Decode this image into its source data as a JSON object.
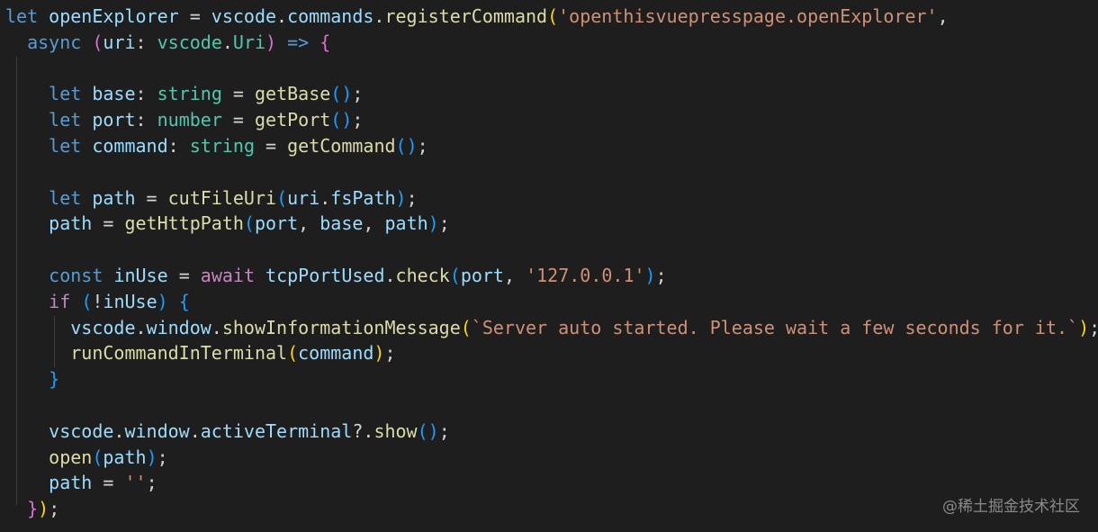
{
  "editor": {
    "lines": [
      [
        [
          "kw",
          "let"
        ],
        [
          "op",
          " "
        ],
        [
          "var",
          "openExplorer"
        ],
        [
          "op",
          " = "
        ],
        [
          "var",
          "vscode"
        ],
        [
          "op",
          "."
        ],
        [
          "var",
          "commands"
        ],
        [
          "op",
          "."
        ],
        [
          "fn",
          "registerCommand"
        ],
        [
          "b1",
          "("
        ],
        [
          "str",
          "'openthisvuepresspage.openExplorer'"
        ],
        [
          "op",
          ","
        ]
      ],
      [
        [
          "op",
          "  "
        ],
        [
          "kw",
          "async"
        ],
        [
          "op",
          " "
        ],
        [
          "b2",
          "("
        ],
        [
          "var",
          "uri"
        ],
        [
          "op",
          ": "
        ],
        [
          "type",
          "vscode"
        ],
        [
          "op",
          "."
        ],
        [
          "type",
          "Uri"
        ],
        [
          "b2",
          ")"
        ],
        [
          "op",
          " "
        ],
        [
          "kw",
          "=>"
        ],
        [
          "op",
          " "
        ],
        [
          "b2",
          "{"
        ]
      ],
      [],
      [
        [
          "op",
          "    "
        ],
        [
          "kw",
          "let"
        ],
        [
          "op",
          " "
        ],
        [
          "var",
          "base"
        ],
        [
          "op",
          ": "
        ],
        [
          "type",
          "string"
        ],
        [
          "op",
          " = "
        ],
        [
          "fn",
          "getBase"
        ],
        [
          "b3",
          "()"
        ],
        [
          "op",
          ";"
        ]
      ],
      [
        [
          "op",
          "    "
        ],
        [
          "kw",
          "let"
        ],
        [
          "op",
          " "
        ],
        [
          "var",
          "port"
        ],
        [
          "op",
          ": "
        ],
        [
          "type",
          "number"
        ],
        [
          "op",
          " = "
        ],
        [
          "fn",
          "getPort"
        ],
        [
          "b3",
          "()"
        ],
        [
          "op",
          ";"
        ]
      ],
      [
        [
          "op",
          "    "
        ],
        [
          "kw",
          "let"
        ],
        [
          "op",
          " "
        ],
        [
          "var",
          "command"
        ],
        [
          "op",
          ": "
        ],
        [
          "type",
          "string"
        ],
        [
          "op",
          " = "
        ],
        [
          "fn",
          "getCommand"
        ],
        [
          "b3",
          "()"
        ],
        [
          "op",
          ";"
        ]
      ],
      [],
      [
        [
          "op",
          "    "
        ],
        [
          "kw",
          "let"
        ],
        [
          "op",
          " "
        ],
        [
          "var",
          "path"
        ],
        [
          "op",
          " = "
        ],
        [
          "fn",
          "cutFileUri"
        ],
        [
          "b3",
          "("
        ],
        [
          "var",
          "uri"
        ],
        [
          "op",
          "."
        ],
        [
          "var",
          "fsPath"
        ],
        [
          "b3",
          ")"
        ],
        [
          "op",
          ";"
        ]
      ],
      [
        [
          "op",
          "    "
        ],
        [
          "var",
          "path"
        ],
        [
          "op",
          " = "
        ],
        [
          "fn",
          "getHttpPath"
        ],
        [
          "b3",
          "("
        ],
        [
          "var",
          "port"
        ],
        [
          "op",
          ", "
        ],
        [
          "var",
          "base"
        ],
        [
          "op",
          ", "
        ],
        [
          "var",
          "path"
        ],
        [
          "b3",
          ")"
        ],
        [
          "op",
          ";"
        ]
      ],
      [],
      [
        [
          "op",
          "    "
        ],
        [
          "kw",
          "const"
        ],
        [
          "op",
          " "
        ],
        [
          "var",
          "inUse"
        ],
        [
          "op",
          " = "
        ],
        [
          "ctl",
          "await"
        ],
        [
          "op",
          " "
        ],
        [
          "var",
          "tcpPortUsed"
        ],
        [
          "op",
          "."
        ],
        [
          "fn",
          "check"
        ],
        [
          "b3",
          "("
        ],
        [
          "var",
          "port"
        ],
        [
          "op",
          ", "
        ],
        [
          "str",
          "'127.0.0.1'"
        ],
        [
          "b3",
          ")"
        ],
        [
          "op",
          ";"
        ]
      ],
      [
        [
          "op",
          "    "
        ],
        [
          "ctl",
          "if"
        ],
        [
          "op",
          " "
        ],
        [
          "b3",
          "("
        ],
        [
          "op",
          "!"
        ],
        [
          "var",
          "inUse"
        ],
        [
          "b3",
          ")"
        ],
        [
          "op",
          " "
        ],
        [
          "b3",
          "{"
        ]
      ],
      [
        [
          "op",
          "      "
        ],
        [
          "var",
          "vscode"
        ],
        [
          "op",
          "."
        ],
        [
          "var",
          "window"
        ],
        [
          "op",
          "."
        ],
        [
          "fn",
          "showInformationMessage"
        ],
        [
          "b1",
          "("
        ],
        [
          "str",
          "`Server auto started. Please wait a few seconds for it.`"
        ],
        [
          "b1",
          ")"
        ],
        [
          "op",
          ";"
        ]
      ],
      [
        [
          "op",
          "      "
        ],
        [
          "fn",
          "runCommandInTerminal"
        ],
        [
          "b1",
          "("
        ],
        [
          "var",
          "command"
        ],
        [
          "b1",
          ")"
        ],
        [
          "op",
          ";"
        ]
      ],
      [
        [
          "op",
          "    "
        ],
        [
          "b3",
          "}"
        ]
      ],
      [],
      [
        [
          "op",
          "    "
        ],
        [
          "var",
          "vscode"
        ],
        [
          "op",
          "."
        ],
        [
          "var",
          "window"
        ],
        [
          "op",
          "."
        ],
        [
          "var",
          "activeTerminal"
        ],
        [
          "op",
          "?."
        ],
        [
          "fn",
          "show"
        ],
        [
          "b3",
          "()"
        ],
        [
          "op",
          ";"
        ]
      ],
      [
        [
          "op",
          "    "
        ],
        [
          "fn",
          "open"
        ],
        [
          "b3",
          "("
        ],
        [
          "var",
          "path"
        ],
        [
          "b3",
          ")"
        ],
        [
          "op",
          ";"
        ]
      ],
      [
        [
          "op",
          "    "
        ],
        [
          "var",
          "path"
        ],
        [
          "op",
          " = "
        ],
        [
          "str",
          "''"
        ],
        [
          "op",
          ";"
        ]
      ],
      [
        [
          "op",
          "  "
        ],
        [
          "b2",
          "}"
        ],
        [
          "b1",
          ")"
        ],
        [
          "op",
          ";"
        ]
      ]
    ]
  },
  "watermark": {
    "text": "@稀土掘金技术社区"
  }
}
